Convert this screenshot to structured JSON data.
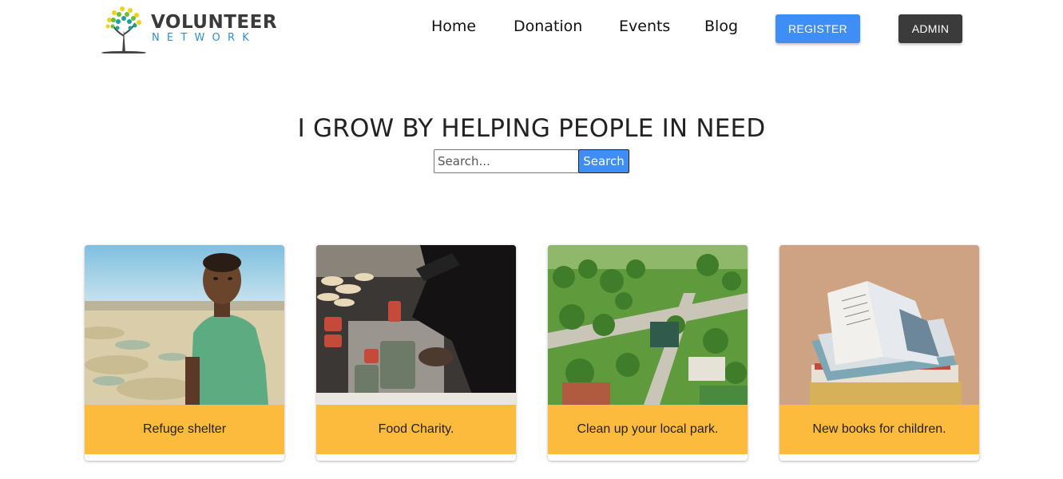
{
  "brand": {
    "line1": "VOLUNTEER",
    "line2": "NETWORK",
    "logo_icon": "tree-icon"
  },
  "nav": {
    "links": [
      "Home",
      "Donation",
      "Events",
      "Blog"
    ],
    "register_label": "REGISTER",
    "admin_label": "ADMIN"
  },
  "hero": {
    "title": "I GROW BY HELPING PEOPLE IN NEED",
    "search_placeholder": "Search...",
    "search_button": "Search"
  },
  "events": [
    {
      "title": "Refuge shelter",
      "image": "child-in-field-photo"
    },
    {
      "title": "Food Charity.",
      "image": "food-donation-photo"
    },
    {
      "title": "Clean up your local park.",
      "image": "park-aerial-photo"
    },
    {
      "title": "New books for children.",
      "image": "books-stack-photo"
    }
  ],
  "colors": {
    "accent_blue": "#3f8ef5",
    "admin_dark": "#3b3b3b",
    "card_caption": "#fdbb3d",
    "brand_blue": "#2f8fd8"
  }
}
